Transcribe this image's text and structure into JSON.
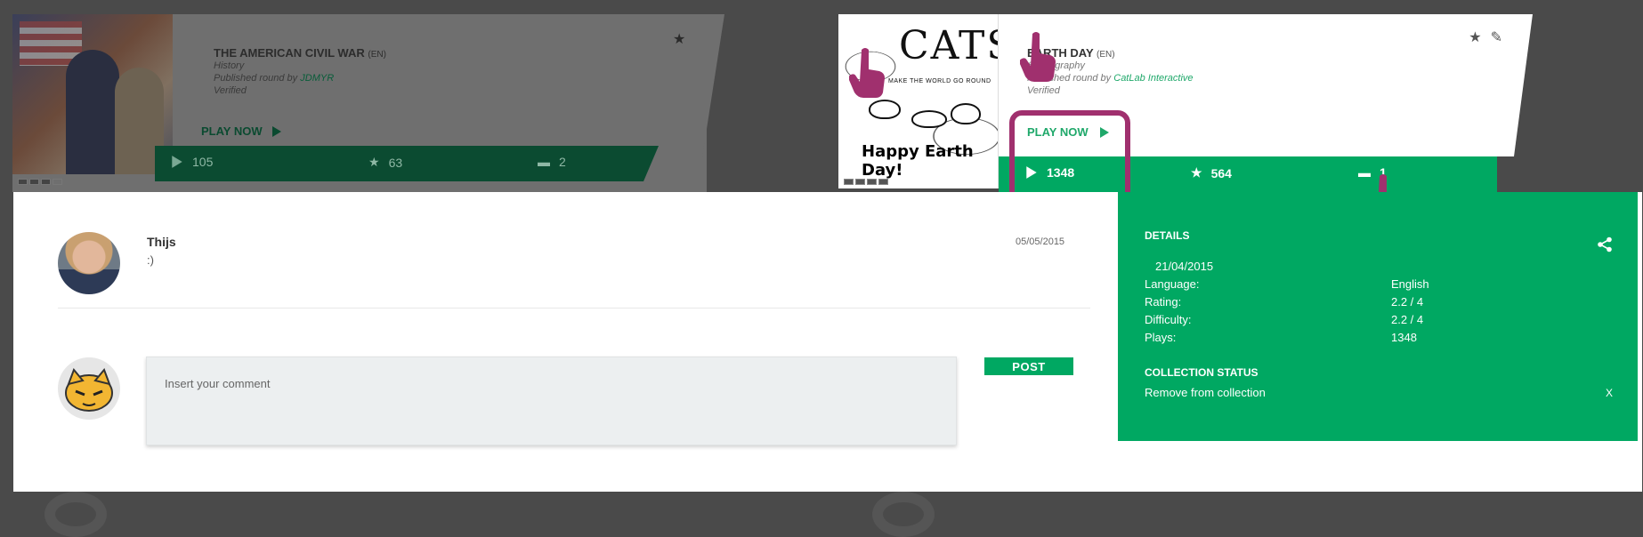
{
  "background_quiz": {
    "title": "THE AMERICAN CIVIL WAR",
    "lang": "(EN)",
    "category": "History",
    "published_prefix": "Published round by",
    "publisher": "JDMYR",
    "status": "Verified",
    "play_label": "PLAY NOW",
    "plays": "105",
    "favorites": "63",
    "comments": "2"
  },
  "quiz": {
    "title": "EARTH DAY",
    "lang": "(EN)",
    "category": "& Geography",
    "published_prefix": "Published round by",
    "publisher": "CatLab Interactive",
    "status": "Verified",
    "play_label": "PLAY NOW",
    "plays": "1348",
    "favorites": "564",
    "comments": "1",
    "image_text_big": "CATS",
    "image_text_small": "MAKE THE WORLD GO ROUND",
    "image_text_bottom": "Happy Earth Day!"
  },
  "comments": {
    "items": [
      {
        "user": "Thijs",
        "text": ":)",
        "date": "05/05/2015"
      }
    ],
    "input_placeholder": "Insert your comment",
    "post_label": "POST"
  },
  "details": {
    "heading": "DETAILS",
    "date": "21/04/2015",
    "rows": [
      {
        "key": "Language:",
        "value": "English"
      },
      {
        "key": "Rating:",
        "value": "2.2 / 4"
      },
      {
        "key": "Difficulty:",
        "value": "2.2 / 4"
      },
      {
        "key": "Plays:",
        "value": "1348"
      }
    ],
    "collection_heading": "COLLECTION STATUS",
    "remove_label": "Remove from collection",
    "close_label": "X"
  },
  "icons": {
    "play": "play-icon",
    "favorite": "star-icon",
    "comment": "comment-icon",
    "edit": "pencil-icon",
    "share": "share-icon",
    "pointer": "hand-pointer-icon"
  },
  "colors": {
    "accent": "#00a862",
    "highlight": "#a0306e",
    "overlay": "#4a4a4a"
  }
}
